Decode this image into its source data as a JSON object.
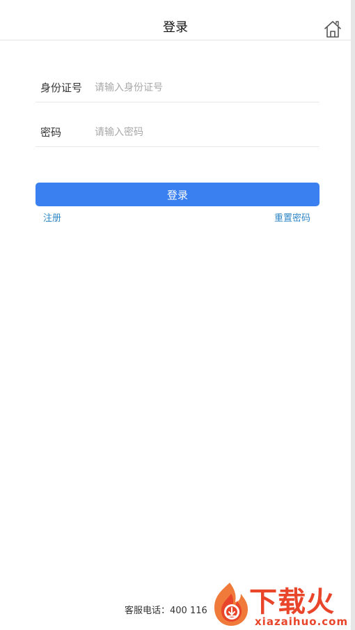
{
  "header": {
    "title": "登录",
    "home_icon": "home-icon"
  },
  "form": {
    "id_number": {
      "label": "身份证号",
      "value": "",
      "placeholder": "请输入身份证号"
    },
    "password": {
      "label": "密码",
      "value": "",
      "placeholder": "请输入密码"
    }
  },
  "actions": {
    "login_label": "登录",
    "register_label": "注册",
    "reset_password_label": "重置密码"
  },
  "footer": {
    "service_phone": "客服电话：400 116"
  },
  "watermark": {
    "brand": "下载火",
    "domain": "xiazaihuo.com"
  },
  "colors": {
    "primary_button": "#3a80f0",
    "link": "#2f86c7",
    "watermark": "#e8452a",
    "divider": "#e8e8e8"
  }
}
